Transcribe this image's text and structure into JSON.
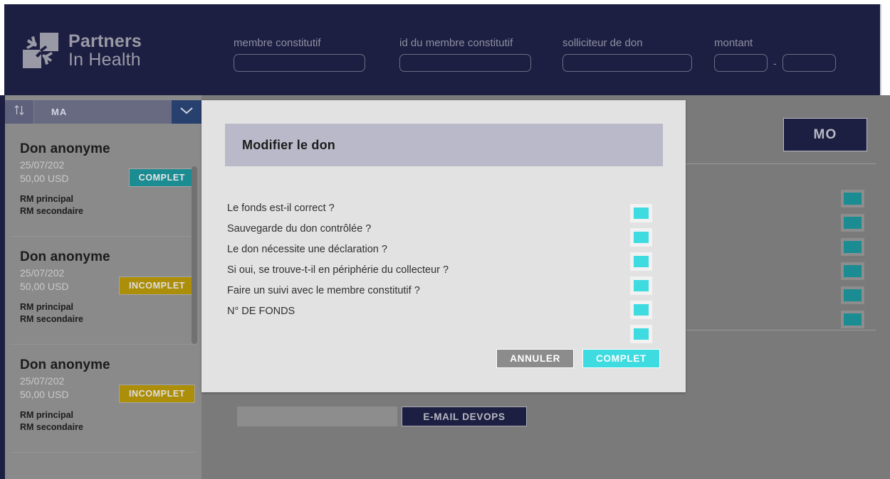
{
  "brand": {
    "line1": "Partners",
    "line2": "In Health",
    "logo_icon": "partners-in-health-hands-logo"
  },
  "header": {
    "filters": [
      {
        "label": "membre constitutif",
        "value": "",
        "placeholder": ""
      },
      {
        "label": "id du membre constitutif",
        "value": "",
        "placeholder": ""
      },
      {
        "label": "solliciteur de don",
        "value": "",
        "placeholder": ""
      }
    ],
    "amount": {
      "label": "montant",
      "min_value": "",
      "max_value": "",
      "separator": "-"
    }
  },
  "sidebar": {
    "sort_icon": "sort-updown-icon",
    "sort_value": "MA",
    "caret_icon": "chevron-down-icon",
    "cards": [
      {
        "title": "Don anonyme",
        "date": "25/07/202",
        "amount": "50,00 USD",
        "status": "COMPLET",
        "status_color": "#1c8c93",
        "rm_primary": "RM principal",
        "rm_secondary": "RM secondaire"
      },
      {
        "title": "Don anonyme",
        "date": "25/07/202",
        "amount": "50,00 USD",
        "status": "INCOMPLET",
        "status_color": "#ad8e09",
        "rm_primary": "RM principal",
        "rm_secondary": "RM secondaire"
      },
      {
        "title": "Don anonyme",
        "date": "25/07/202",
        "amount": "50,00 USD",
        "status": "INCOMPLET",
        "status_color": "#ad8e09",
        "rm_primary": "RM principal",
        "rm_secondary": "RM secondaire"
      }
    ]
  },
  "content": {
    "mo_button": "MO",
    "background_checkbox_count": 6,
    "background_checkbox_color": "#1c8c93",
    "devops": {
      "input_value": "",
      "button_label": "E-MAIL DEVOPS"
    }
  },
  "modal": {
    "title": "Modifier le don",
    "questions": [
      "Le fonds est-il correct ?",
      "Sauvegarde du don contrôlée ?",
      "Le don nécessite une déclaration ?",
      "Si oui, se trouve-t-il en périphérie du collecteur ?",
      "Faire un suivi avec le membre constitutif ?",
      "N° DE FONDS"
    ],
    "checkbox_count": 6,
    "checkbox_color": "#3edbe0",
    "buttons": {
      "cancel": "ANNULER",
      "confirm": "COMPLET"
    }
  },
  "colors": {
    "navy": "#1d1f42",
    "grey_overlay": "#7a7a7a",
    "teal": "#1c8c93",
    "cyan": "#3edbe0",
    "gold": "#ad8e09"
  }
}
